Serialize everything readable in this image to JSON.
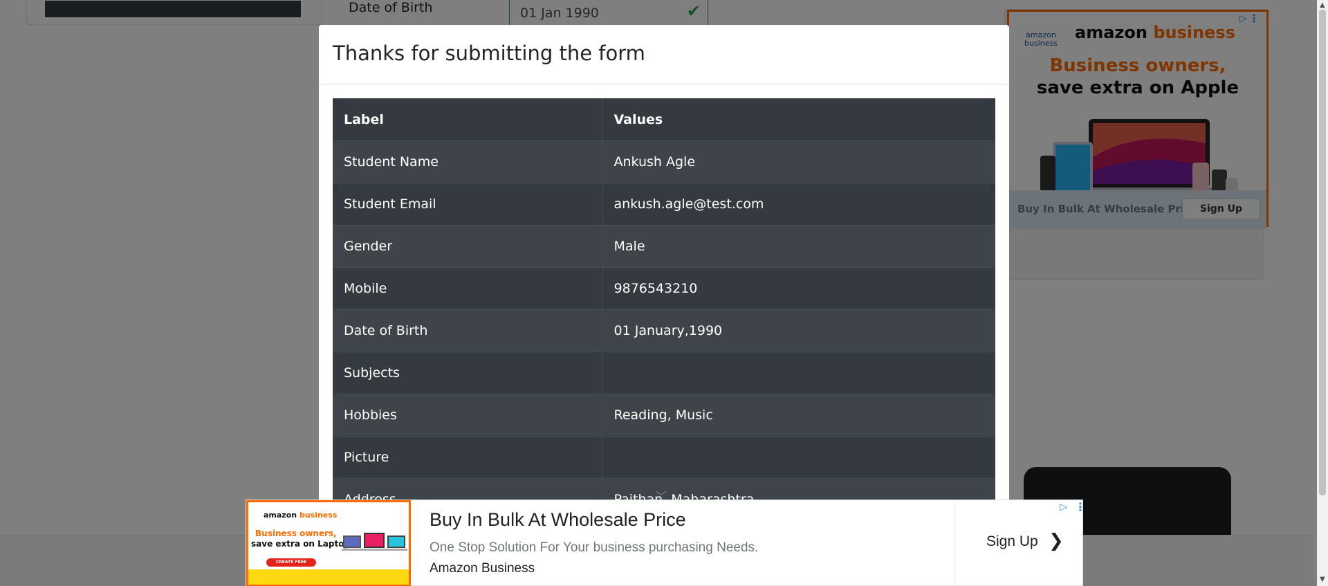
{
  "background_form": {
    "dob_label": "Date of Birth",
    "dob_value": "01 Jan 1990",
    "check_glyph": "✔"
  },
  "modal": {
    "title": "Thanks for submitting the form",
    "columns": [
      "Label",
      "Values"
    ],
    "rows": [
      {
        "label": "Student Name",
        "value": "Ankush Agle"
      },
      {
        "label": "Student Email",
        "value": "ankush.agle@test.com"
      },
      {
        "label": "Gender",
        "value": "Male"
      },
      {
        "label": "Mobile",
        "value": "9876543210"
      },
      {
        "label": "Date of Birth",
        "value": "01 January,1990"
      },
      {
        "label": "Subjects",
        "value": ""
      },
      {
        "label": "Hobbies",
        "value": "Reading, Music"
      },
      {
        "label": "Picture",
        "value": ""
      },
      {
        "label": "Address",
        "value": "Paithan, Maharashtra"
      }
    ]
  },
  "right_ad": {
    "small_logo_line1": "amazon",
    "small_logo_line2": "business",
    "logo_amazon": "amazon",
    "logo_business": "business",
    "headline_line1": "Business owners,",
    "headline_line2": "save extra on Apple",
    "cta_text": "Buy In Bulk At Wholesale Price",
    "cta_button": "Sign Up",
    "adchoices_glyph": "▷",
    "menu_glyph": "⋮"
  },
  "bottom_ad": {
    "thumb_logo_amazon": "amazon",
    "thumb_logo_business": "business",
    "thumb_headline1": "Business owners,",
    "thumb_headline2": "save extra on Laptops",
    "thumb_button": "CREATE FREE ACCOUNT",
    "title": "Buy In Bulk At Wholesale Price",
    "description": "One Stop Solution For Your business purchasing Needs.",
    "brand": "Amazon Business",
    "signup": "Sign Up",
    "chevron_glyph": "❯",
    "adchoices_glyph": "▷",
    "menu_glyph": "⋮",
    "collapse_glyph": "﹀"
  },
  "scrollbar": {
    "up_glyph": "▲",
    "down_glyph": "▼"
  },
  "colors": {
    "accent_orange": "#ff6a00",
    "success_green": "#28a745",
    "table_dark": "#343a40"
  }
}
